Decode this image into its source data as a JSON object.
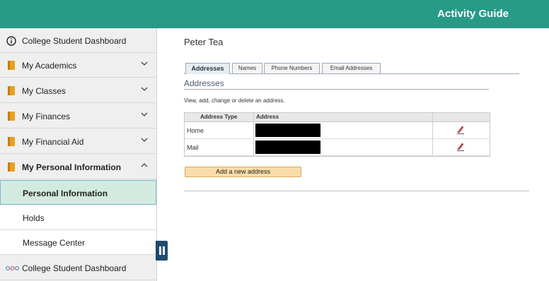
{
  "header": {
    "title": "Activity Guide",
    "bg_color": "#279a88"
  },
  "sidebar": {
    "items": [
      {
        "label": "College Student Dashboard",
        "icon": "info-circle-icon"
      },
      {
        "label": "My Academics",
        "icon": "book-icon",
        "expanded": false
      },
      {
        "label": "My Classes",
        "icon": "book-icon",
        "expanded": false
      },
      {
        "label": "My Finances",
        "icon": "book-icon",
        "expanded": false
      },
      {
        "label": "My Financial Aid",
        "icon": "book-icon",
        "expanded": false
      },
      {
        "label": "My Personal Information",
        "icon": "book-icon",
        "expanded": true
      },
      {
        "label": "Personal Information",
        "selected": true
      },
      {
        "label": "Holds"
      },
      {
        "label": "Message Center"
      },
      {
        "label": "College Student Dashboard",
        "icon": "app-dots-icon"
      }
    ],
    "book_color": "#e8a020"
  },
  "main": {
    "user_name": "Peter Tea",
    "tabs": [
      {
        "label": "Addresses",
        "active": true
      },
      {
        "label": "Names"
      },
      {
        "label": "Phone Numbers"
      },
      {
        "label": "Email Addresses"
      }
    ],
    "section_title": "Addresses",
    "instructions": "View, add, change or delete an address.",
    "grid": {
      "headers": [
        "Address Type",
        "Address"
      ],
      "rows": [
        {
          "type": "Home",
          "address": ""
        },
        {
          "type": "Mail",
          "address": ""
        }
      ]
    },
    "add_button": "Add a new address"
  }
}
